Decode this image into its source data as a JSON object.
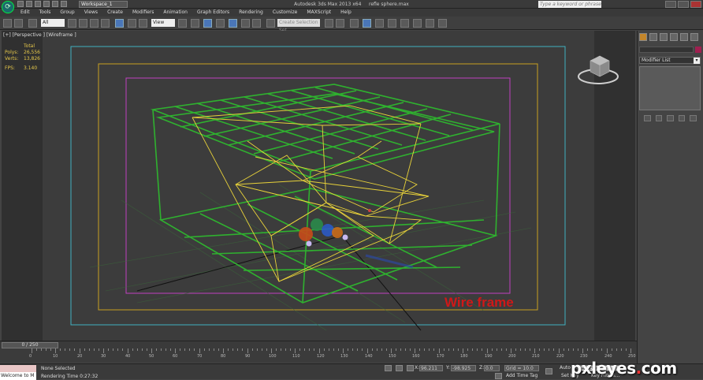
{
  "titlebar": {
    "workspace": "Workspace_1",
    "app_title": "Autodesk 3ds Max 2013 x64",
    "file_name": "refle sphere.max",
    "search_placeholder": "Type a keyword or phrase"
  },
  "menu": [
    "Edit",
    "Tools",
    "Group",
    "Views",
    "Create",
    "Modifiers",
    "Animation",
    "Graph Editors",
    "Rendering",
    "Customize",
    "MAXScript",
    "Help"
  ],
  "toolbar": {
    "selection_filter": "All",
    "ref_coord": "View",
    "named_selection": "Create Selection Set"
  },
  "viewport": {
    "label": "[+] [Perspective ] [Wireframe ]",
    "stats_header": "Total",
    "stats": [
      {
        "key": "Polys:",
        "value": "26,556"
      },
      {
        "key": "Verts:",
        "value": "13,826"
      },
      {
        "key": "FPS:",
        "value": "3.140"
      }
    ],
    "annotation": "Wire frame"
  },
  "command_panel": {
    "modifier_list": "Modifier List"
  },
  "timeline": {
    "frame_display": "0 / 250",
    "ticks": [
      "0",
      "10",
      "20",
      "30",
      "40",
      "50",
      "60",
      "70",
      "80",
      "90",
      "100",
      "110",
      "120",
      "130",
      "140",
      "150",
      "160",
      "170",
      "180",
      "190",
      "200",
      "210",
      "220",
      "230",
      "240",
      "250"
    ]
  },
  "status": {
    "maxscript_text": "Welcome to M",
    "selection": "None Selected",
    "render_time": "Rendering Time  0:27:32",
    "x_label": "X:",
    "x_value": "96.211",
    "y_label": "Y:",
    "y_value": "-98.925",
    "z_label": "Z:",
    "z_value": "0.0",
    "grid": "Grid = 10.0",
    "add_time_tag": "Add Time Tag",
    "auto_key": "Auto Key",
    "auto_key_mode": "Selected",
    "set_key": "Set Key",
    "key_filters": "Key Filters..."
  },
  "watermark": {
    "text": "pxleyes",
    "dot": ".",
    "tld": "com"
  },
  "colors": {
    "grid_green": "#2fb12f",
    "lines_yellow": "#e8d23a",
    "safe_frame_magenta": "#c040c0",
    "safe_frame_cyan": "#40b0c0",
    "safe_frame_yellow": "#c8a020",
    "annotation_red": "#d01818"
  }
}
